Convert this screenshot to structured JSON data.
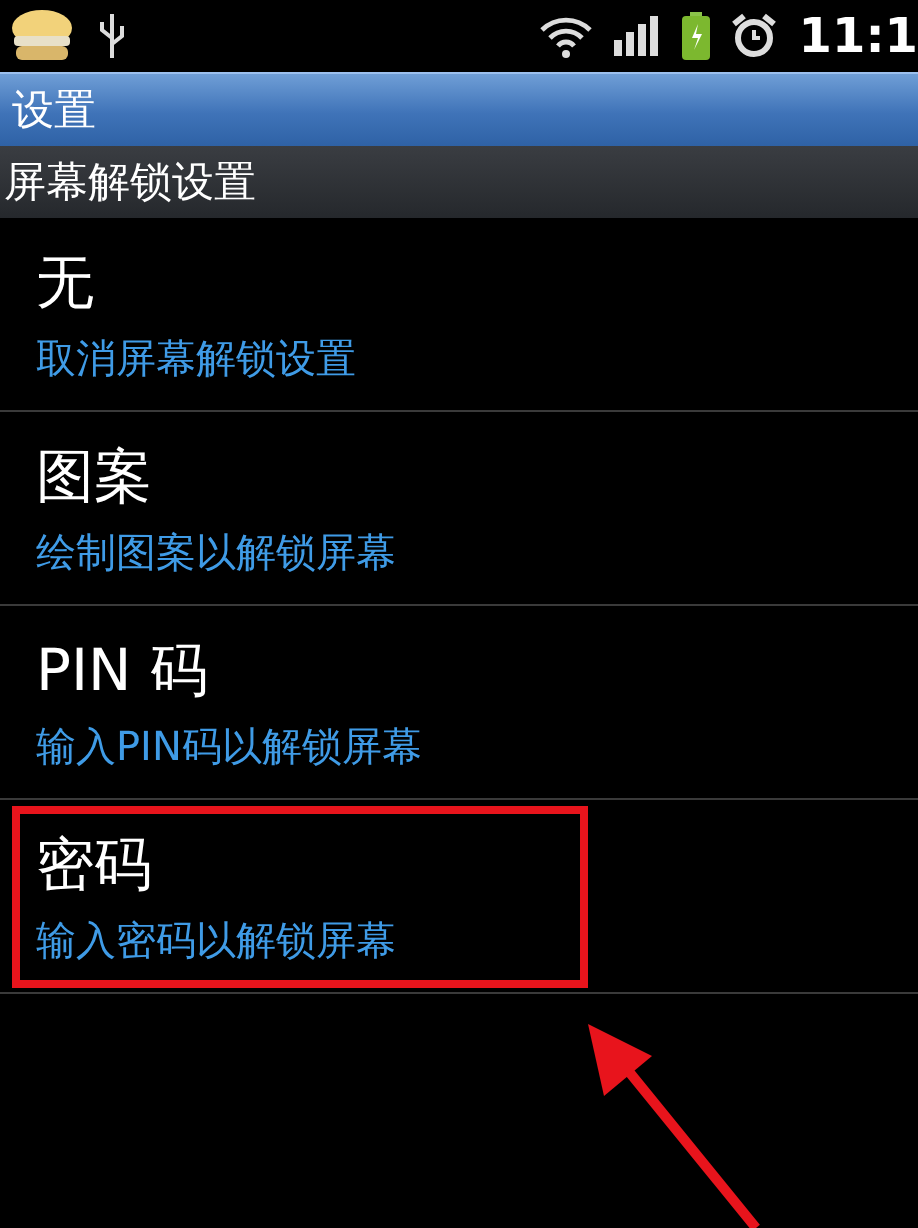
{
  "status_bar": {
    "time": "11:1"
  },
  "title_bar": {
    "title": "设置"
  },
  "section_header": {
    "title": "屏幕解锁设置"
  },
  "options": [
    {
      "title": "无",
      "subtitle": "取消屏幕解锁设置",
      "highlighted": false
    },
    {
      "title": "图案",
      "subtitle": "绘制图案以解锁屏幕",
      "highlighted": false
    },
    {
      "title": "PIN 码",
      "subtitle": "输入PIN码以解锁屏幕",
      "highlighted": false
    },
    {
      "title": "密码",
      "subtitle": "输入密码以解锁屏幕",
      "highlighted": true
    }
  ],
  "annotation": {
    "kind": "arrow"
  }
}
